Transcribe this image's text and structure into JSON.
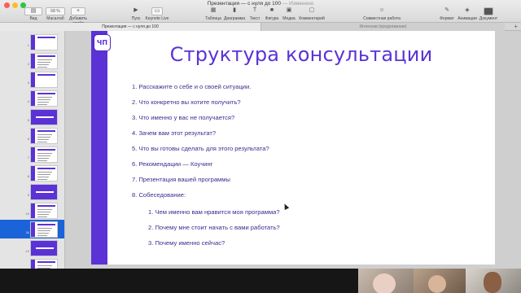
{
  "window": {
    "title": "Презентация — с нуля до 100",
    "title_suffix": "— Изменено",
    "traffic_colors": [
      "#fc5f57",
      "#fdbc2e",
      "#28c840"
    ]
  },
  "toolbar": {
    "view": "Вид",
    "zoom_value": "68 %",
    "zoom_label": "Масштаб",
    "add_slide": "Добавить слайд",
    "play": "Пуск",
    "keynote_live": "Keynote Live",
    "table": "Таблица",
    "chart": "Диаграмма",
    "text": "Текст",
    "shape": "Фигура",
    "media": "Медиа",
    "comment": "Комментарий",
    "collaborate": "Совместная работа",
    "format": "Формат",
    "animate": "Анимации",
    "document": "Документ"
  },
  "tabs": [
    {
      "label": "Презентация — с нуля до 100"
    },
    {
      "label": "Интенсив (продолжение)"
    }
  ],
  "navigator": {
    "slides": [
      {
        "num": "1",
        "kind": "title"
      },
      {
        "num": "2",
        "kind": "text"
      },
      {
        "num": "3",
        "kind": "title"
      },
      {
        "num": "4",
        "kind": "text"
      },
      {
        "num": "5",
        "kind": "purple"
      },
      {
        "num": "6",
        "kind": "text"
      },
      {
        "num": "7",
        "kind": "text"
      },
      {
        "num": "8",
        "kind": "text"
      },
      {
        "num": "9",
        "kind": "purple"
      },
      {
        "num": "10",
        "kind": "text"
      },
      {
        "num": "11",
        "kind": "text",
        "selected": true
      },
      {
        "num": "12",
        "kind": "purple"
      },
      {
        "num": "13",
        "kind": "text"
      }
    ]
  },
  "slide": {
    "logo": "ЧП",
    "title": "Структура консультации",
    "accent": "#5b32d6",
    "questions": [
      "1.  Расскажите о себе и о своей ситуации.",
      "2.  Что конкретно вы хотите получить?",
      "3.  Что именно у вас не получается?",
      "4.  Зачем вам этот результат?",
      "5.  Что вы готовы сделать для этого результата?",
      "6.  Рекомендации — Коучинг",
      "7.  Презентация вашей программы",
      "8.  Собеседование:"
    ],
    "subquestions": [
      "1.  Чем именно вам нравится моя программа?",
      "2.  Почему мне стоит начать с вами работать?",
      "3.  Почему именно сейчас?"
    ]
  }
}
